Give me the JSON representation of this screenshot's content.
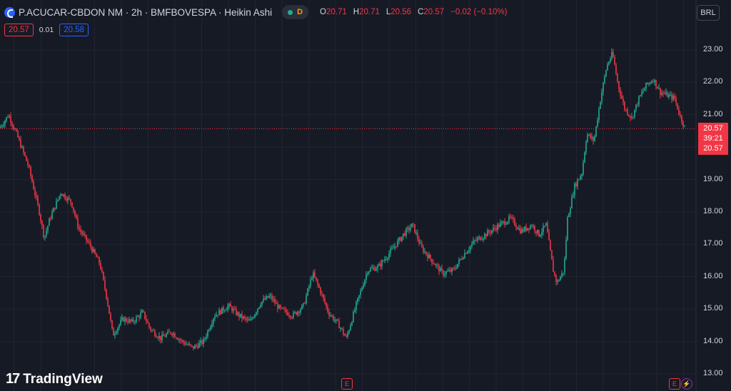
{
  "header": {
    "title": "P.ACUCAR-CBDON NM · 2h · BMFBOVESPA · Heikin Ashi",
    "interval_badge": "D",
    "ohlc": [
      {
        "k": "O",
        "v": "20.71"
      },
      {
        "k": "H",
        "v": "20.71"
      },
      {
        "k": "L",
        "v": "20.56"
      },
      {
        "k": "C",
        "v": "20.57"
      },
      {
        "k": "",
        "v": "−0.02 (−0.10%)"
      }
    ],
    "bid": "20.57",
    "spread": "0.01",
    "ask": "20.58",
    "currency": "BRL"
  },
  "last_price": {
    "price": "20.57",
    "countdown": "39:21",
    "price2": "20.57"
  },
  "events": [
    "E",
    "E"
  ],
  "lightning_icon": "lightning-icon",
  "logo_text": "TradingView",
  "colors": {
    "up": "#22ab94",
    "down": "#f23645",
    "bg": "#161a25",
    "grid": "#232632",
    "accent": "#2962ff"
  },
  "chart_data": {
    "type": "candlestick",
    "style": "Heikin Ashi",
    "ylim": [
      13.0,
      23.4
    ],
    "y_ticks": [
      "23.00",
      "22.00",
      "21.00",
      "20.00",
      "19.00",
      "18.00",
      "17.00",
      "16.00",
      "15.00",
      "14.00",
      "13.00"
    ],
    "y_tick_values": [
      23,
      22,
      21,
      20,
      19,
      18,
      17,
      16,
      15,
      14,
      13
    ],
    "price_path": [
      [
        0,
        20.6
      ],
      [
        12,
        21.0
      ],
      [
        25,
        20.3
      ],
      [
        40,
        19.4
      ],
      [
        55,
        18.0
      ],
      [
        62,
        17.2
      ],
      [
        70,
        17.8
      ],
      [
        85,
        18.6
      ],
      [
        100,
        18.3
      ],
      [
        110,
        17.5
      ],
      [
        125,
        17.0
      ],
      [
        140,
        16.4
      ],
      [
        150,
        15.3
      ],
      [
        158,
        14.2
      ],
      [
        172,
        14.7
      ],
      [
        185,
        14.6
      ],
      [
        200,
        14.9
      ],
      [
        210,
        14.4
      ],
      [
        225,
        14.1
      ],
      [
        240,
        14.3
      ],
      [
        255,
        14.0
      ],
      [
        270,
        13.8
      ],
      [
        285,
        14.0
      ],
      [
        300,
        14.8
      ],
      [
        320,
        15.1
      ],
      [
        335,
        14.8
      ],
      [
        350,
        14.6
      ],
      [
        365,
        15.2
      ],
      [
        378,
        15.4
      ],
      [
        392,
        15.0
      ],
      [
        410,
        14.8
      ],
      [
        425,
        15.1
      ],
      [
        438,
        16.1
      ],
      [
        448,
        15.6
      ],
      [
        460,
        14.9
      ],
      [
        475,
        14.5
      ],
      [
        485,
        14.1
      ],
      [
        500,
        15.2
      ],
      [
        515,
        16.2
      ],
      [
        530,
        16.3
      ],
      [
        548,
        16.8
      ],
      [
        565,
        17.3
      ],
      [
        578,
        17.6
      ],
      [
        590,
        16.9
      ],
      [
        605,
        16.5
      ],
      [
        620,
        16.1
      ],
      [
        635,
        16.2
      ],
      [
        650,
        16.7
      ],
      [
        665,
        17.1
      ],
      [
        680,
        17.3
      ],
      [
        700,
        17.6
      ],
      [
        715,
        17.8
      ],
      [
        730,
        17.4
      ],
      [
        745,
        17.6
      ],
      [
        755,
        17.3
      ],
      [
        765,
        17.6
      ],
      [
        775,
        16.2
      ],
      [
        780,
        15.8
      ],
      [
        790,
        16.2
      ],
      [
        795,
        17.8
      ],
      [
        805,
        18.8
      ],
      [
        815,
        19.2
      ],
      [
        822,
        20.4
      ],
      [
        832,
        20.2
      ],
      [
        842,
        21.6
      ],
      [
        850,
        22.5
      ],
      [
        858,
        22.9
      ],
      [
        866,
        21.9
      ],
      [
        875,
        21.2
      ],
      [
        885,
        20.9
      ],
      [
        895,
        21.5
      ],
      [
        905,
        21.9
      ],
      [
        915,
        22.1
      ],
      [
        925,
        21.7
      ],
      [
        935,
        21.6
      ],
      [
        945,
        21.5
      ],
      [
        952,
        21.0
      ],
      [
        960,
        20.57
      ]
    ]
  }
}
